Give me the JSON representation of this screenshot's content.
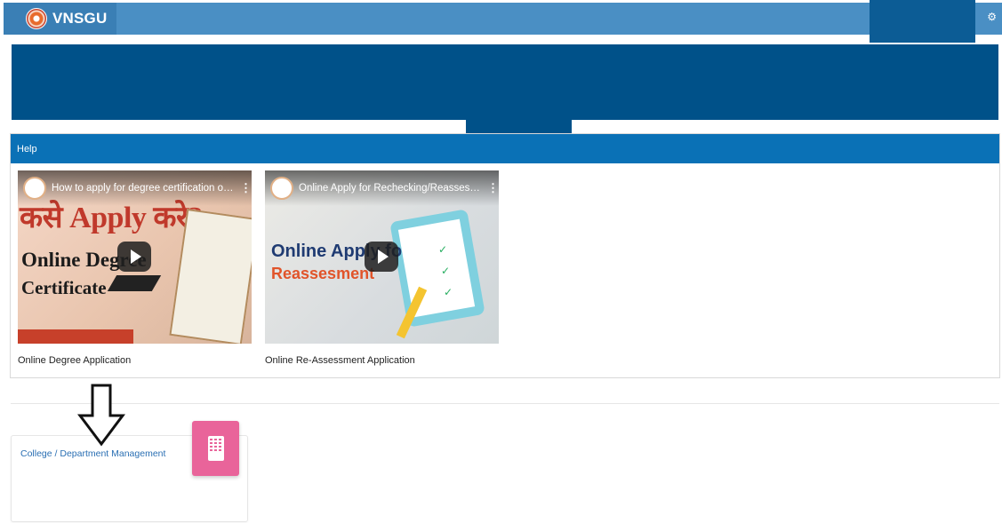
{
  "header": {
    "brand": "VNSGU",
    "settings_icon": "gear-icon"
  },
  "help": {
    "title": "Help",
    "videos": [
      {
        "title": "How to apply for degree certification onlin...",
        "caption": "Online Degree Application",
        "thumb_line_hindi": "कसे Apply करे?",
        "thumb_line_1": "Online Degree",
        "thumb_line_2": "Certificate"
      },
      {
        "title": "Online Apply for Rechecking/Reassessme...",
        "caption": "Online Re-Assessment Application",
        "thumb_line_1": "Online Apply fo",
        "thumb_line_2": "Reassesment"
      }
    ]
  },
  "cards": [
    {
      "label": "College / Department Management",
      "icon": "building-icon"
    }
  ],
  "colors": {
    "topbar": "#4a8fc4",
    "banner": "#005189",
    "help_header": "#0a71b6",
    "card_icon": "#e9649a"
  }
}
